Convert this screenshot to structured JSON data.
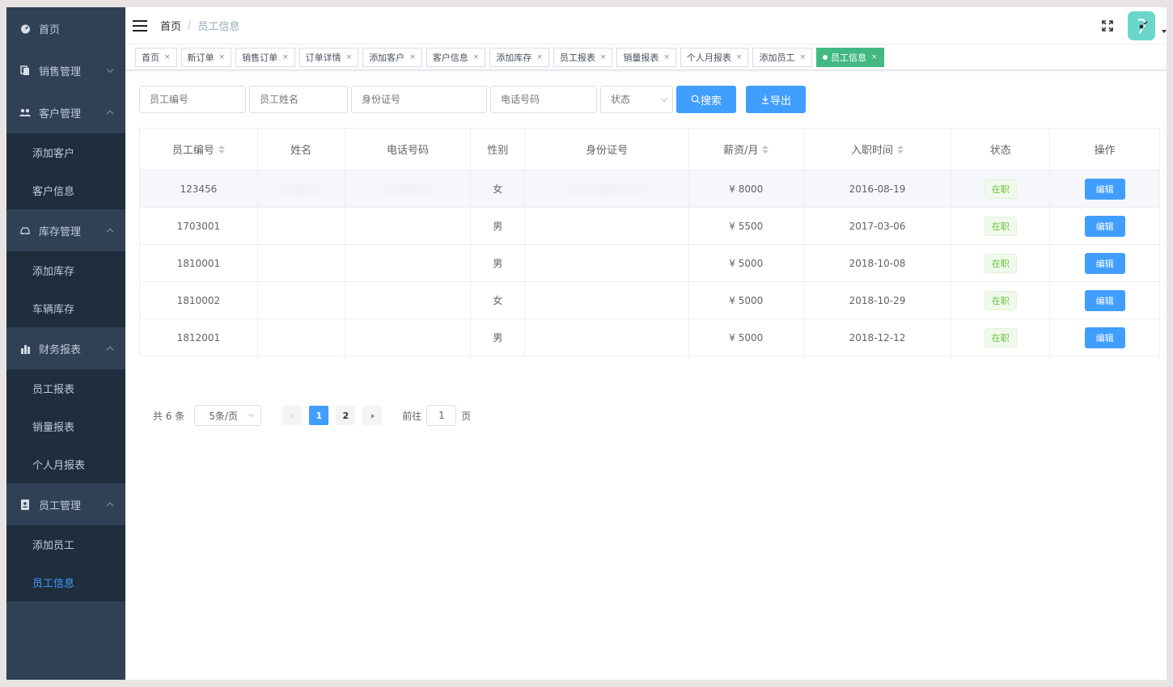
{
  "sidebar": {
    "groups": [
      {
        "label": "首页",
        "icon": "dashboard-icon",
        "children": []
      },
      {
        "label": "销售管理",
        "icon": "document-icon",
        "expanded": false,
        "children": []
      },
      {
        "label": "客户管理",
        "icon": "people-icon",
        "expanded": true,
        "children": [
          "添加客户",
          "客户信息"
        ]
      },
      {
        "label": "库存管理",
        "icon": "car-icon",
        "expanded": true,
        "children": [
          "添加库存",
          "车辆库存"
        ]
      },
      {
        "label": "财务报表",
        "icon": "bar-chart-icon",
        "expanded": true,
        "children": [
          "员工报表",
          "销量报表",
          "个人月报表"
        ]
      },
      {
        "label": "员工管理",
        "icon": "user-badge-icon",
        "expanded": true,
        "children": [
          "添加员工",
          "员工信息"
        ]
      }
    ],
    "active_item": "员工信息"
  },
  "header": {
    "breadcrumb_home": "首页",
    "breadcrumb_sep": "/",
    "breadcrumb_current": "员工信息"
  },
  "tags": [
    {
      "label": "首页",
      "active": false
    },
    {
      "label": "新订单",
      "active": false
    },
    {
      "label": "销售订单",
      "active": false
    },
    {
      "label": "订单详情",
      "active": false
    },
    {
      "label": "添加客户",
      "active": false
    },
    {
      "label": "客户信息",
      "active": false
    },
    {
      "label": "添加库存",
      "active": false
    },
    {
      "label": "员工报表",
      "active": false
    },
    {
      "label": "销量报表",
      "active": false
    },
    {
      "label": "个人月报表",
      "active": false
    },
    {
      "label": "添加员工",
      "active": false
    },
    {
      "label": "员工信息",
      "active": true
    }
  ],
  "tag_close": "×",
  "filters": {
    "employee_id_placeholder": "员工编号",
    "name_placeholder": "员工姓名",
    "idcard_placeholder": "身份证号",
    "phone_placeholder": "电话号码",
    "status_placeholder": "状态",
    "search_label": "搜索",
    "export_label": "导出"
  },
  "table": {
    "columns": [
      "员工编号",
      "姓名",
      "电话号码",
      "性别",
      "身份证号",
      "薪资/月",
      "入职时间",
      "状态",
      "操作"
    ],
    "rows": [
      {
        "id": "123456",
        "name": "",
        "phone": "",
        "gender": "女",
        "idcard": "",
        "salary": "¥ 8000",
        "hired": "2016-08-19",
        "status": "在职",
        "action": "编辑"
      },
      {
        "id": "1703001",
        "name": "",
        "phone": "",
        "gender": "男",
        "idcard": "",
        "salary": "¥ 5500",
        "hired": "2017-03-06",
        "status": "在职",
        "action": "编辑"
      },
      {
        "id": "1810001",
        "name": "",
        "phone": "",
        "gender": "男",
        "idcard": "",
        "salary": "¥ 5000",
        "hired": "2018-10-08",
        "status": "在职",
        "action": "编辑"
      },
      {
        "id": "1810002",
        "name": "",
        "phone": "",
        "gender": "女",
        "idcard": "",
        "salary": "¥ 5000",
        "hired": "2018-10-29",
        "status": "在职",
        "action": "编辑"
      },
      {
        "id": "1812001",
        "name": "",
        "phone": "",
        "gender": "男",
        "idcard": "",
        "salary": "¥ 5000",
        "hired": "2018-12-12",
        "status": "在职",
        "action": "编辑"
      }
    ]
  },
  "pagination": {
    "total": "共 6 条",
    "page_size": "5条/页",
    "pages": [
      "1",
      "2"
    ],
    "current_page": "1",
    "goto_prefix": "前往",
    "goto_value": "1",
    "goto_suffix": "页"
  },
  "colors": {
    "sidebar_bg": "#304156",
    "submenu_bg": "#1f2d3d",
    "primary": "#409eff",
    "active_tag": "#42b983",
    "status_green": "#67c23a"
  }
}
